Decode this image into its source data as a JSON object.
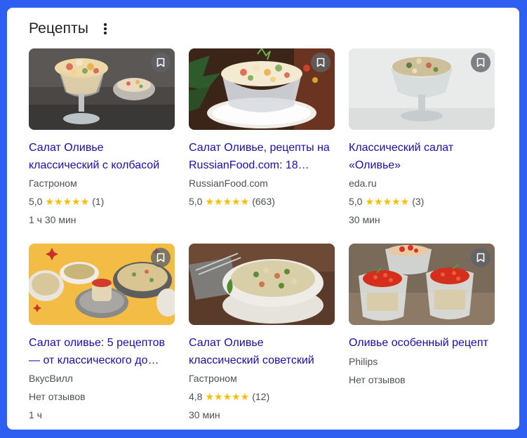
{
  "header": {
    "title": "Рецепты",
    "menu_icon": "more-vert-icon"
  },
  "colors": {
    "link": "#1a0dab",
    "star": "#fbbc04",
    "frame": "#2f5ff0"
  },
  "recipes": [
    {
      "title": "Салат Оливье классический с колбасой",
      "source": "Гастроном",
      "rating": "5,0",
      "stars": "★★★★★",
      "reviews": "(1)",
      "time": "1 ч 30 мин"
    },
    {
      "title": "Салат Оливье, рецепты на RussianFood.com: 18…",
      "source": "RussianFood.com",
      "rating": "5,0",
      "stars": "★★★★★",
      "reviews": "(663)",
      "time": ""
    },
    {
      "title": "Классический салат «Оливье»",
      "source": "eda.ru",
      "rating": "5,0",
      "stars": "★★★★★",
      "reviews": "(3)",
      "time": "30 мин"
    },
    {
      "title": "Салат оливье: 5 рецептов — от классического до…",
      "source": "ВкусВилл",
      "no_reviews": "Нет отзывов",
      "time": "1 ч"
    },
    {
      "title": "Салат Оливье классический советский",
      "source": "Гастроном",
      "rating": "4,8",
      "stars": "★★★★★",
      "reviews": "(12)",
      "time": "30 мин"
    },
    {
      "title": "Оливье особенный рецепт",
      "source": "Philips",
      "no_reviews": "Нет отзывов"
    }
  ]
}
